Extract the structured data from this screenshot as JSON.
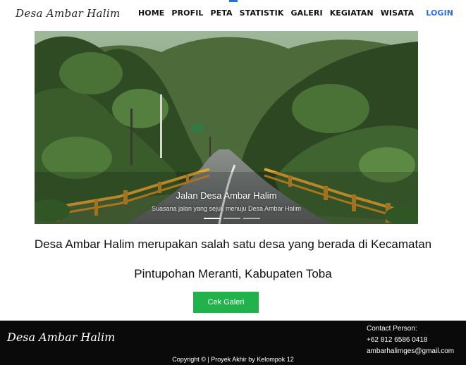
{
  "header": {
    "brand": "Desa Ambar Halim",
    "nav": [
      "HOME",
      "PROFIL",
      "PETA",
      "STATISTIK",
      "GALERI",
      "KEGIATAN",
      "WISATA"
    ],
    "login": "LOGIN"
  },
  "hero": {
    "title": "Jalan Desa Ambar Halim",
    "subtitle": "Suasana jalan yang sejuk menuju Desa Ambar Halim",
    "slide_count": 3,
    "active_slide": 1
  },
  "intro": {
    "line1": "Desa Ambar Halim merupakan salah satu desa yang berada di Kecamatan",
    "line2": "Pintupohan Meranti, Kabupaten Toba",
    "button": "Cek Galeri"
  },
  "footer": {
    "brand": "Desa Ambar Halim",
    "contact_label": "Contact Person:",
    "phone": "+62 812 6586 0418",
    "email": "ambarhalimges@gmail.com",
    "copyright": "Copyright © | Proyek Akhir by Kelompok 12"
  },
  "colors": {
    "accent_green": "#22b24c",
    "login_blue": "#2f6fd6",
    "footer_bg": "#0a0a0a"
  }
}
